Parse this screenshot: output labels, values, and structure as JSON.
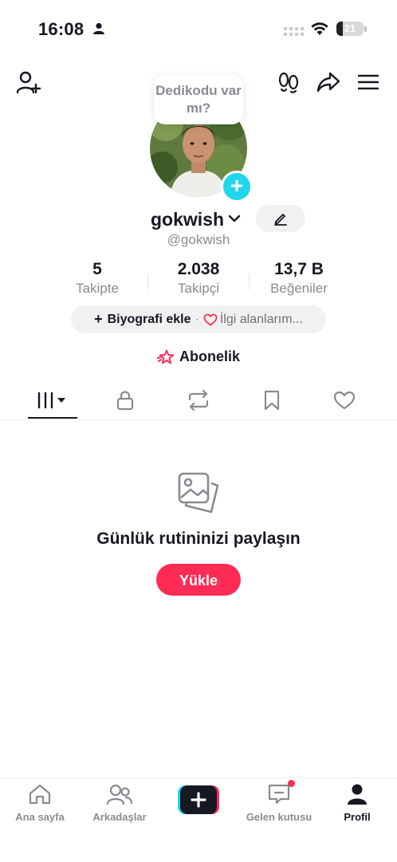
{
  "status_bar": {
    "time": "16:08",
    "battery": "21"
  },
  "bubble": {
    "text": "Dedikodu var mı?"
  },
  "profile": {
    "username": "gokwish",
    "handle": "@gokwish",
    "stats": [
      {
        "value": "5",
        "label": "Takipte"
      },
      {
        "value": "2.038",
        "label": "Takipçi"
      },
      {
        "value": "13,7 B",
        "label": "Beğeniler"
      }
    ],
    "bio_button": "Biyografi ekle",
    "separator": "·",
    "interests": "İlgi alanlarım...",
    "subscription": "Abonelik"
  },
  "empty_state": {
    "title": "Günlük rutininizi paylaşın",
    "upload_label": "Yükle"
  },
  "bottom_nav": [
    {
      "label": "Ana sayfa"
    },
    {
      "label": "Arkadaşlar"
    },
    {
      "label": ""
    },
    {
      "label": "Gelen kutusu"
    },
    {
      "label": "Profil"
    }
  ],
  "colors": {
    "accent": "#fe2c55",
    "badge": "#20d5ec",
    "muted": "#8a8b91"
  }
}
